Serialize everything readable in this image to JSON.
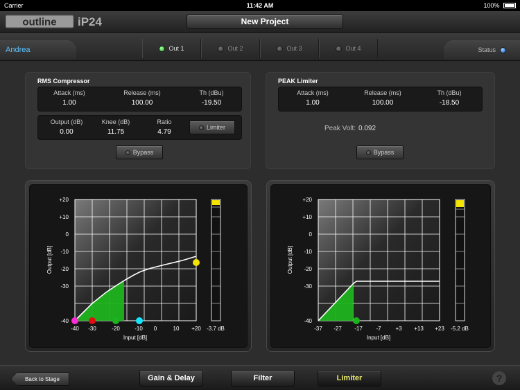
{
  "status_bar": {
    "carrier": "Carrier",
    "time": "11:42 AM",
    "battery": "100%"
  },
  "header": {
    "app_logo": "outline iP24",
    "project_title": "New Project"
  },
  "tabs": {
    "user": "Andrea",
    "outputs": [
      {
        "label": "Out 1",
        "active": true
      },
      {
        "label": "Out 2",
        "active": false
      },
      {
        "label": "Out 3",
        "active": false
      },
      {
        "label": "Out 4",
        "active": false
      }
    ],
    "status_label": "Status"
  },
  "rms": {
    "title": "RMS Compressor",
    "attack_label": "Attack (ms)",
    "attack": "1.00",
    "release_label": "Release (ms)",
    "release": "100.00",
    "th_label": "Th (dBu)",
    "th": "-19.50",
    "output_label": "Output (dB)",
    "output": "0.00",
    "knee_label": "Knee (dB)",
    "knee": "11.75",
    "ratio_label": "Ratio",
    "ratio": "4.79",
    "limiter_label": "Limiter",
    "bypass_label": "Bypass"
  },
  "peak": {
    "title": "PEAK Limiter",
    "attack_label": "Attack (ms)",
    "attack": "1.00",
    "release_label": "Release (ms)",
    "release": "100.00",
    "th_label": "Th (dBu)",
    "th": "-18.50",
    "peak_volt_label": "Peak Volt:",
    "peak_volt": "0.092",
    "bypass_label": "Bypass"
  },
  "graphs": {
    "left": {
      "ylabel": "Output [dB]",
      "xlabel": "Input [dB]",
      "yticks": [
        "+20",
        "+10",
        "0",
        "-10",
        "-20",
        "-30",
        "-40"
      ],
      "xticks": [
        "-40",
        "-30",
        "-20",
        "-10",
        "0",
        "10",
        "+20"
      ],
      "meter_value": "-3.7 dB"
    },
    "right": {
      "ylabel": "Output [dB]",
      "xlabel": "Input [dB]",
      "yticks": [
        "+20",
        "+10",
        "0",
        "-10",
        "-20",
        "-30",
        "-40"
      ],
      "xticks": [
        "-37",
        "-27",
        "-17",
        "-7",
        "+3",
        "+13",
        "+23"
      ],
      "meter_value": "-5.2 dB"
    }
  },
  "colors": {
    "accent_blue": "#5cc3ff",
    "curve_fill": "#1db31d",
    "meter_yellow": "#f5e400",
    "active_tab": "#e7e76a"
  },
  "bottom": {
    "back": "Back to Stage",
    "gain_delay": "Gain & Delay",
    "filter": "Filter",
    "limiter": "Limiter",
    "help": "?"
  }
}
